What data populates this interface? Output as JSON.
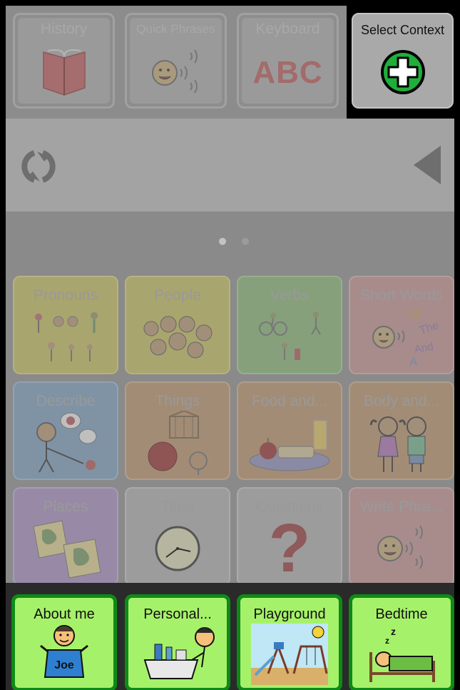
{
  "toolbar": {
    "history_label": "History",
    "quick_phrases_label": "Quick Phrases",
    "keyboard_label": "Keyboard",
    "keyboard_art": "ABC",
    "select_context_label": "Select Context"
  },
  "page_dots": {
    "count": 2,
    "current": 1
  },
  "categories": [
    {
      "label": "Pronouns",
      "color": "#a9a56e"
    },
    {
      "label": "People",
      "color": "#a9a56e"
    },
    {
      "label": "Verbs",
      "color": "#87a07c"
    },
    {
      "label": "Short Words",
      "color": "#a88c8c"
    },
    {
      "label": "Describe",
      "color": "#7f93a5"
    },
    {
      "label": "Things",
      "color": "#a38c76"
    },
    {
      "label": "Food and...",
      "color": "#a38c76"
    },
    {
      "label": "Body and...",
      "color": "#a38c76"
    },
    {
      "label": "Places",
      "color": "#988aa7"
    },
    {
      "label": "Time",
      "color": "#9c9c9c"
    },
    {
      "label": "Questions",
      "color": "#9c9c9c"
    },
    {
      "label": "Write Phra...",
      "color": "#a88c8c"
    }
  ],
  "short_words_art": [
    "Of",
    "The",
    "And",
    "A"
  ],
  "questions_art": "?",
  "contexts": [
    {
      "label": "About me",
      "badge": "Joe"
    },
    {
      "label": "Personal..."
    },
    {
      "label": "Playground"
    },
    {
      "label": "Bedtime"
    }
  ],
  "colors": {
    "context_fill": "#a6f16a",
    "context_border": "#0d8a17",
    "select_context_plus": "#1fae3a"
  }
}
